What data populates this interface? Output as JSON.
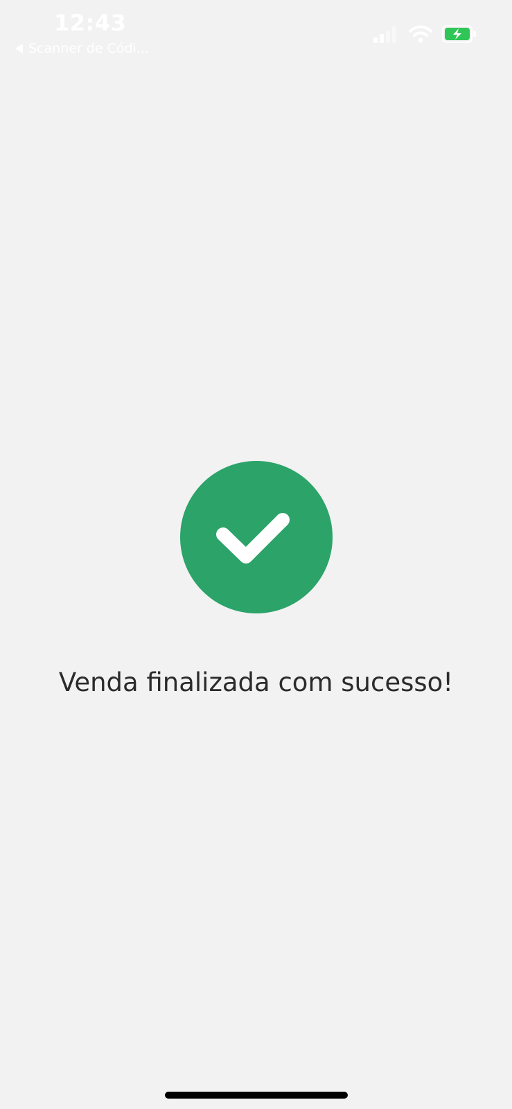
{
  "status_bar": {
    "time": "12:43",
    "back_label": "Scanner de Códi...",
    "icons": [
      "signal-icon",
      "wifi-icon",
      "battery-charging-icon"
    ],
    "battery_color": "#2fc557"
  },
  "main": {
    "icon": "checkmark-icon",
    "accent_color": "#2ba369",
    "message": "Venda finalizada com sucesso!"
  }
}
